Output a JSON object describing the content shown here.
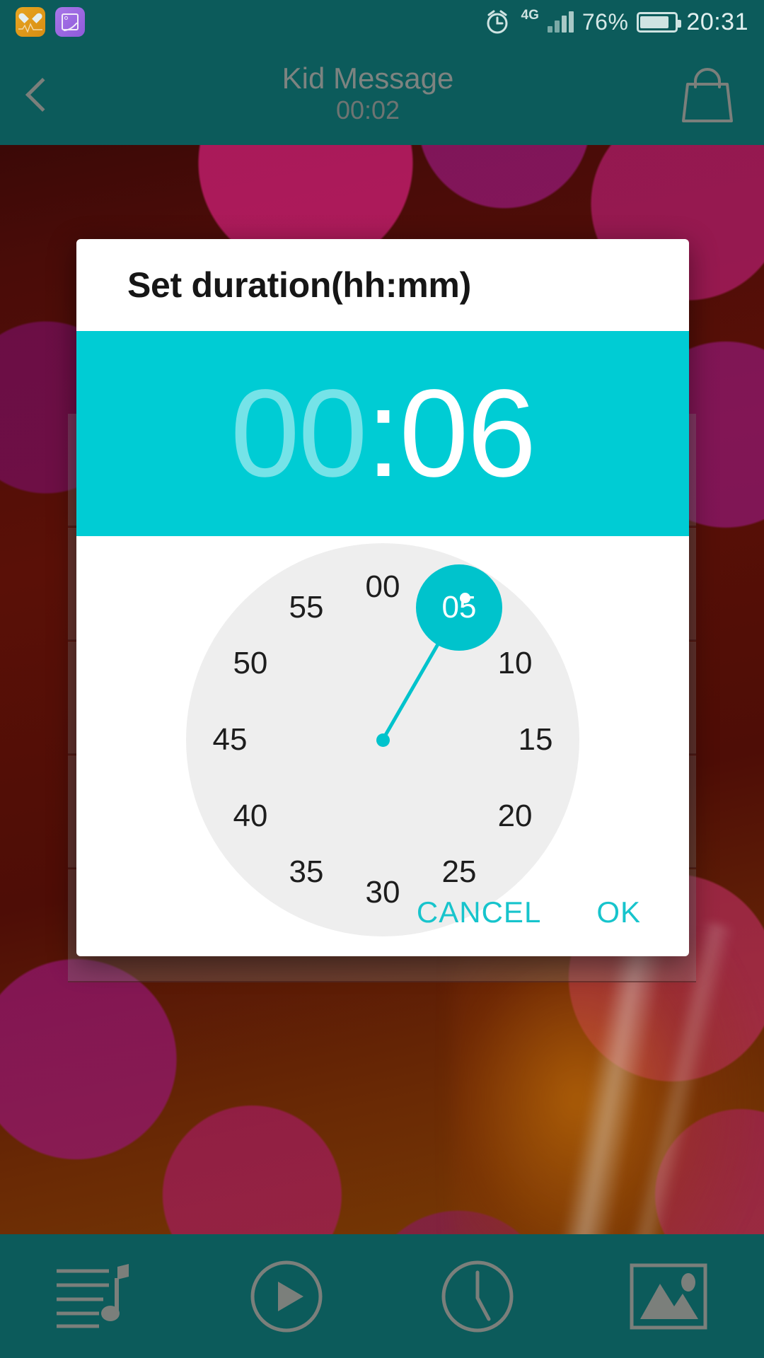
{
  "status_bar": {
    "notifications": [
      {
        "icon": "health-heart-icon",
        "color": "#e0981b"
      },
      {
        "icon": "photo-gallery-icon",
        "color": "#9966e0"
      }
    ],
    "alarm_icon": "alarm-clock-icon",
    "network_type": "4G",
    "signal_icon": "signal-bars-icon",
    "battery_percent": "76%",
    "battery_icon": "battery-icon",
    "time": "20:31"
  },
  "app_bar": {
    "back_icon": "back-chevron-icon",
    "title": "Kid Message",
    "subtitle": "00:02",
    "bag_icon": "handbag-icon"
  },
  "dialog": {
    "title": "Set duration(hh:mm)",
    "time": {
      "hours": "00",
      "separator": ":",
      "minutes": "06",
      "selected_field": "minutes"
    },
    "accent_color": "#00ccd4",
    "clock": {
      "mode": "minutes",
      "selected_value": "05",
      "selected_angle_deg": 30,
      "ticks": [
        "00",
        "05",
        "10",
        "15",
        "20",
        "25",
        "30",
        "35",
        "40",
        "45",
        "50",
        "55"
      ]
    },
    "buttons": {
      "cancel": "CANCEL",
      "ok": "OK"
    }
  },
  "bottom_nav": {
    "items": [
      {
        "icon": "playlist-music-icon",
        "label": ""
      },
      {
        "icon": "play-circle-icon",
        "label": ""
      },
      {
        "icon": "clock-icon",
        "label": ""
      },
      {
        "icon": "image-gallery-icon",
        "label": ""
      }
    ]
  }
}
